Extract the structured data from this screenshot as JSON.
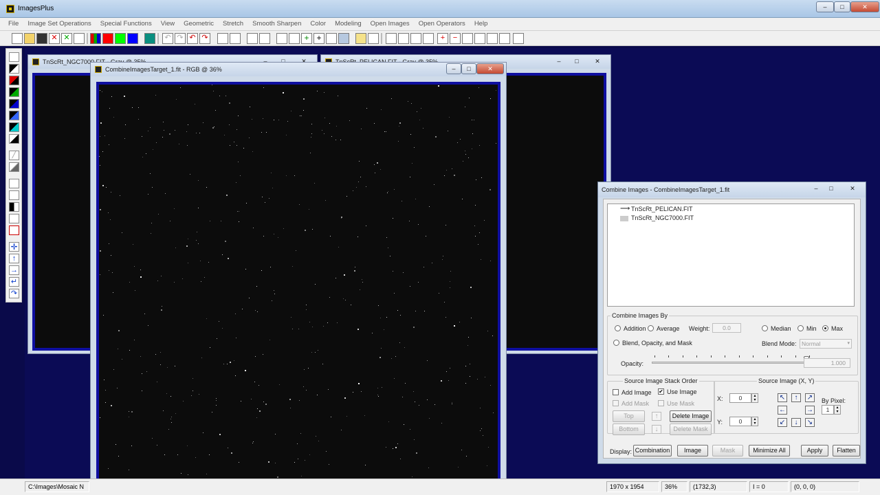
{
  "app": {
    "title": "ImagesPlus"
  },
  "menu": [
    "File",
    "Image Set Operations",
    "Special Functions",
    "View",
    "Geometric",
    "Stretch",
    "Smooth Sharpen",
    "Color",
    "Modeling",
    "Open Images",
    "Open Operators",
    "Help"
  ],
  "windows": {
    "ngc": {
      "title": "TnScRt_NGC7000.FIT - Gray @ 35%"
    },
    "pelican": {
      "title": "TnScRt_PELICAN.FIT - Gray @ 35%"
    },
    "target": {
      "title": "CombineImagesTarget_1.fit - RGB @ 36%"
    }
  },
  "dialog": {
    "title": "Combine Images - CombineImagesTarget_1.fit",
    "tree_items": [
      "TnScRt_PELICAN.FIT",
      "TnScRt_NGC7000.FIT"
    ],
    "combine_by": {
      "legend": "Combine Images By",
      "addition": "Addition",
      "average": "Average",
      "weight_label": "Weight:",
      "weight_value": "0.0",
      "median": "Median",
      "min": "Min",
      "max": "Max",
      "selected": "Max",
      "blend": "Blend, Opacity, and Mask",
      "blend_mode_label": "Blend Mode:",
      "blend_mode_value": "Normal",
      "opacity_label": "Opacity:",
      "opacity_value": "1.000",
      "opacity_fraction": 1.0
    },
    "stack_order": {
      "legend": "Source Image Stack Order",
      "add_image": "Add Image",
      "use_image": "Use Image",
      "use_image_checked": true,
      "add_mask": "Add Mask",
      "use_mask": "Use Mask",
      "top": "Top",
      "bottom": "Bottom",
      "delete_image": "Delete Image",
      "delete_mask": "Delete Mask"
    },
    "source_xy": {
      "legend": "Source Image (X, Y)",
      "x_label": "X:",
      "x_value": "0",
      "y_label": "Y:",
      "y_value": "0",
      "by_pixel_label": "By Pixel:",
      "by_pixel_value": "1"
    },
    "display": {
      "label": "Display:",
      "combination": "Combination",
      "image": "Image",
      "mask": "Mask",
      "minimize_all": "Minimize All",
      "apply": "Apply",
      "flatten": "Flatten"
    }
  },
  "status": {
    "path": "C:\\Images\\Mosaic N",
    "size": "1970 x 1954",
    "zoom": "36%",
    "coords": "(1732,3)",
    "intensity": "I = 0",
    "rgb": "(0, 0, 0)"
  }
}
